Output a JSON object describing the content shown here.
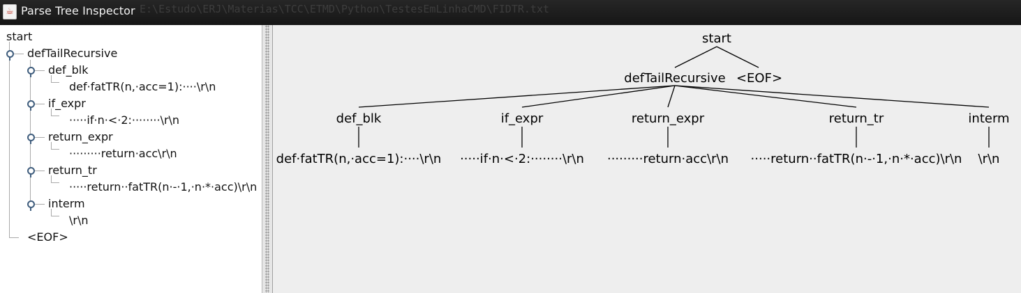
{
  "window": {
    "title": "Parse Tree Inspector",
    "background_path_text": "E:\\Estudo\\ERJ\\Materias\\TCC\\ETMD\\Python\\TestesEmLinhaCMD\\FIDTR.txt"
  },
  "tree": {
    "root": "start",
    "child": "defTailRecursive",
    "eof": "<EOF>",
    "rules": [
      {
        "name": "def_blk",
        "text": "def·fatTR(n,·acc=1):····\\r\\n"
      },
      {
        "name": "if_expr",
        "text": "·····if·n·<·2:········\\r\\n"
      },
      {
        "name": "return_expr",
        "text": "·········return·acc\\r\\n"
      },
      {
        "name": "return_tr",
        "text": "·····return··fatTR(n·-·1,·n·*·acc)\\r\\n"
      },
      {
        "name": "interm",
        "text": "\\r\\n"
      }
    ]
  },
  "graph": {
    "root": "start",
    "child": "defTailRecursive",
    "eof": "<EOF>",
    "rules": [
      "def_blk",
      "if_expr",
      "return_expr",
      "return_tr",
      "interm"
    ],
    "leaves": [
      "def·fatTR(n,·acc=1):····\\r\\n",
      "·····if·n·<·2:········\\r\\n",
      "·········return·acc\\r\\n",
      "·····return··fatTR(n·-·1,·n·*·acc)\\r\\n",
      "\\r\\n"
    ]
  },
  "colors": {
    "titlebar": "#1c1c1c",
    "tree_background": "#ffffff",
    "canvas_background": "#eeeeee",
    "handle": "#3f5d7d"
  },
  "icons": {
    "app": "java-cup-icon",
    "expand_handle": "tree-expand-handle-icon"
  }
}
